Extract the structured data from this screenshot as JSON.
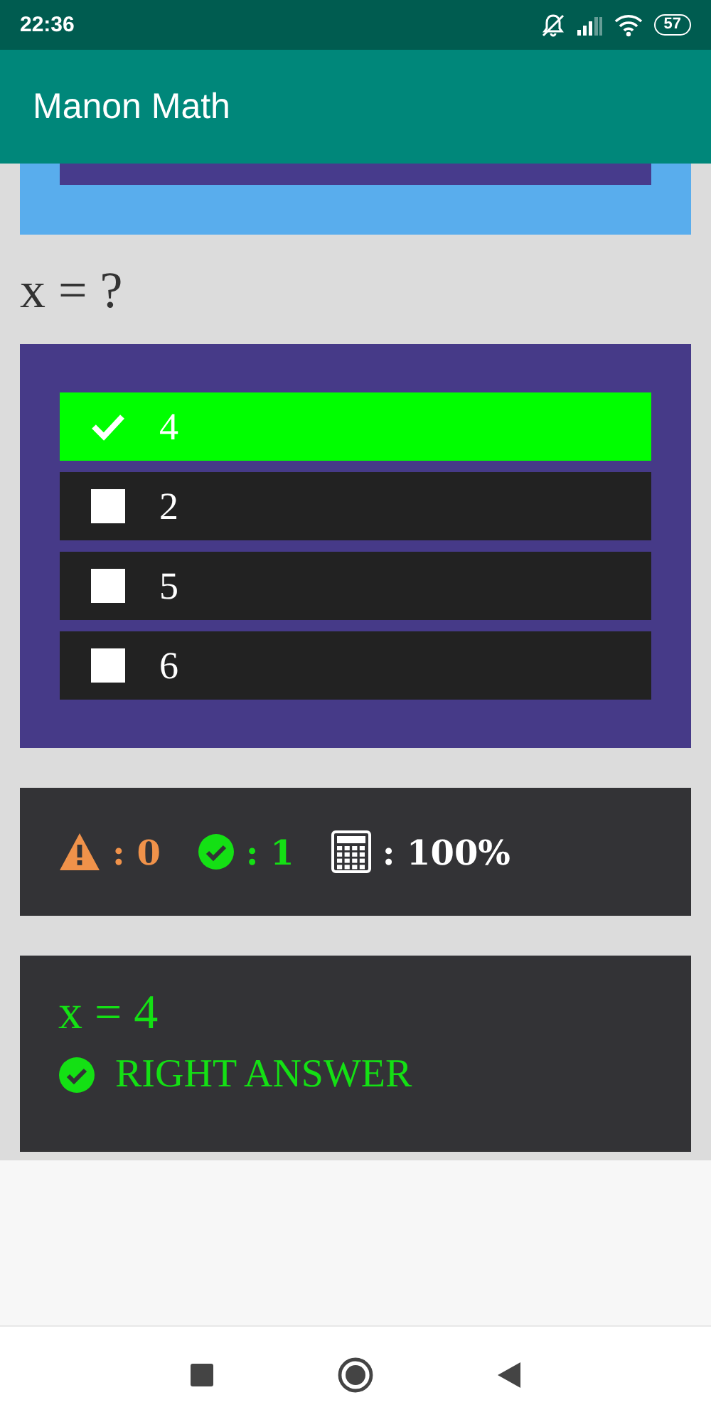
{
  "status_bar": {
    "time": "22:36",
    "battery": "57"
  },
  "app_bar": {
    "title": "Manon Math"
  },
  "question": {
    "prompt": "x = ?"
  },
  "options": [
    {
      "label": "4",
      "selected": true
    },
    {
      "label": "2",
      "selected": false
    },
    {
      "label": "5",
      "selected": false
    },
    {
      "label": "6",
      "selected": false
    }
  ],
  "stats": [
    {
      "kind": "warning",
      "text": ": 0",
      "color": "#f0924a"
    },
    {
      "kind": "correct",
      "text": ": 1",
      "color": "#14e014"
    },
    {
      "kind": "score",
      "text": ": 100%",
      "color": "#ffffff"
    }
  ],
  "result": {
    "kind": "correct",
    "equation": "x = 4",
    "message": "RIGHT ANSWER"
  }
}
